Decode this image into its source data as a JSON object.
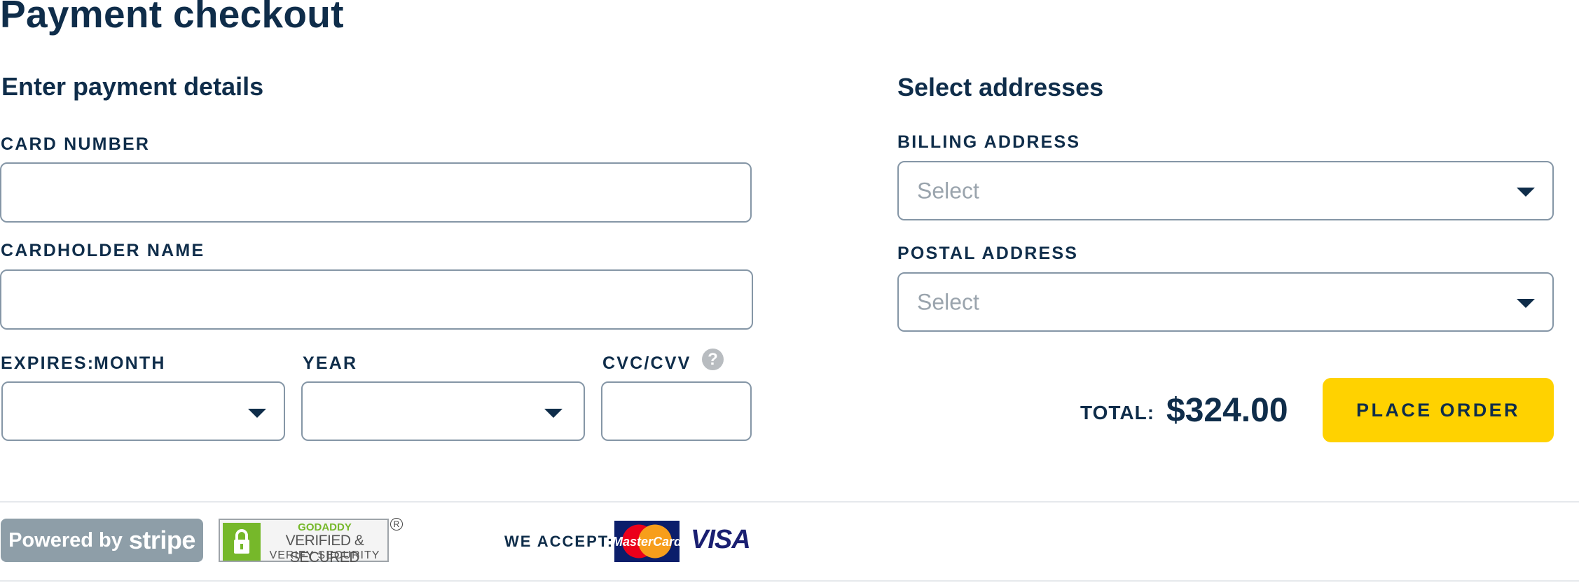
{
  "page": {
    "title": "Payment checkout"
  },
  "payment": {
    "heading": "Enter payment details",
    "card_number_label": "CARD NUMBER",
    "card_number_value": "",
    "cardholder_label": "CARDHOLDER NAME",
    "cardholder_value": "",
    "expires_label": "EXPIRES:",
    "month_label": "MONTH",
    "month_value": "",
    "year_label": "YEAR",
    "year_value": "",
    "cvc_label": "CVC/CVV",
    "cvc_value": "",
    "help_glyph": "?"
  },
  "addresses": {
    "heading": "Select addresses",
    "billing_label": "BILLING ADDRESS",
    "billing_placeholder": "Select",
    "postal_label": "POSTAL ADDRESS",
    "postal_placeholder": "Select"
  },
  "order": {
    "total_label": "TOTAL:",
    "total_value": "$324.00",
    "button_label": "PLACE ORDER"
  },
  "footer": {
    "stripe_prefix": "Powered by",
    "stripe_brand": "stripe",
    "godaddy_line1": "GODADDY",
    "godaddy_line2": "VERIFIED & SECURED",
    "godaddy_line3": "VERIFY SECURITY",
    "godaddy_reg": "R",
    "accept_label": "WE ACCEPT:",
    "mastercard_label": "MasterCard",
    "visa_label": "VISA"
  },
  "colors": {
    "text": "#0f2d4a",
    "button": "#ffd200",
    "field_border": "#8596a6",
    "stripe_badge": "#8e9ea8",
    "godaddy_green": "#76b82a"
  }
}
